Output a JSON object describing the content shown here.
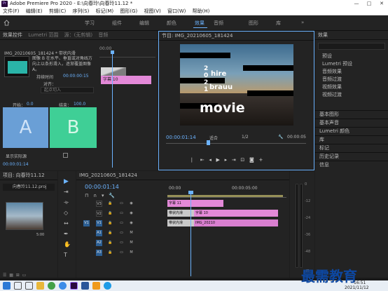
{
  "titlebar": {
    "icon": "Pr",
    "title": "Adobe Premiere Pro 2020 - E:\\向春玲\\向春玲11.12 *",
    "minimize": "—",
    "maximize": "□",
    "close": "✕"
  },
  "menubar": {
    "items": [
      "文件(F)",
      "编辑(E)",
      "剪辑(C)",
      "序列(S)",
      "标记(M)",
      "图形(G)",
      "视图(V)",
      "窗口(W)",
      "帮助(H)"
    ]
  },
  "workspaces": {
    "tabs": [
      "学习",
      "组件",
      "编辑",
      "颜色",
      "效果",
      "音频",
      "图形",
      "库"
    ],
    "active": "效果",
    "more": "»"
  },
  "effect_controls": {
    "tabs": [
      "效果控件",
      "Lumetri 范围",
      "源：(无剪辑)",
      "音频"
    ],
    "clip_path": "IMG_20210605_181424 * 带状内滑",
    "timecode_start": "00:00",
    "description": "图像 B 在水平、垂直或对角线方向上以条形滑入，逐渐覆盖图像 A。",
    "duration_label": "持续时间",
    "duration_value": "00:00:00:15",
    "align_label": "对齐：",
    "align_value": "起点切入",
    "start_label": "开始：",
    "start_value": "0.0",
    "end_label": "结束：",
    "end_value": "100.0",
    "a_label": "A",
    "b_label": "B",
    "show_actual_label": "显示实际源",
    "mini_clip_label": "字幕 10",
    "bottom_timecode": "00:00:01:14"
  },
  "program_monitor": {
    "title": "节目: IMG_20210605_181424",
    "timecode": "00:00:01:14",
    "fit": "适合",
    "resolution": "1/2",
    "duration": "00:00:05",
    "overlay_text": {
      "hire": "hire",
      "brauu": "brauu",
      "movie": "movie",
      "num": "2\n0\n2\n1"
    }
  },
  "effects_panel": {
    "title": "效果",
    "search_placeholder": "",
    "folders": [
      "预设",
      "Lumetri 预设",
      "音频效果",
      "音频过渡",
      "视频效果",
      "视频过渡"
    ],
    "sections": [
      "基本图形",
      "基本声音",
      "Lumetri 颜色",
      "库",
      "标记",
      "历史记录",
      "信息"
    ]
  },
  "project": {
    "title": "项目: 向春玲11.12",
    "file": "向春玲11.12.proj",
    "clip_duration": "5:00"
  },
  "timeline": {
    "title": "IMG_20210605_181424",
    "timecode": "00:00:01:14",
    "ruler": [
      "00:00",
      "00:00:05:00"
    ],
    "video_tracks": [
      "V3",
      "V2",
      "V1"
    ],
    "audio_tracks": [
      "A1",
      "A2",
      "A3"
    ],
    "clips": {
      "v3": "字幕 11",
      "v2_left": "带状内滑",
      "v2_right": "字幕 10",
      "v1_left": "带状内滑",
      "v1_right": "IMG_20210"
    },
    "db_labels": [
      "0",
      "-12",
      "-24",
      "-36",
      "-48",
      "dB"
    ]
  },
  "taskbar": {
    "time": "16:51",
    "date": "2021/11/12",
    "watermark": "最需教育"
  },
  "colors": {
    "accent": "#6cb3ff",
    "pink_clip": "#e389d8",
    "a_block": "#6a9fd6",
    "b_block": "#3fcf96",
    "transition": "#c9c9c9"
  }
}
